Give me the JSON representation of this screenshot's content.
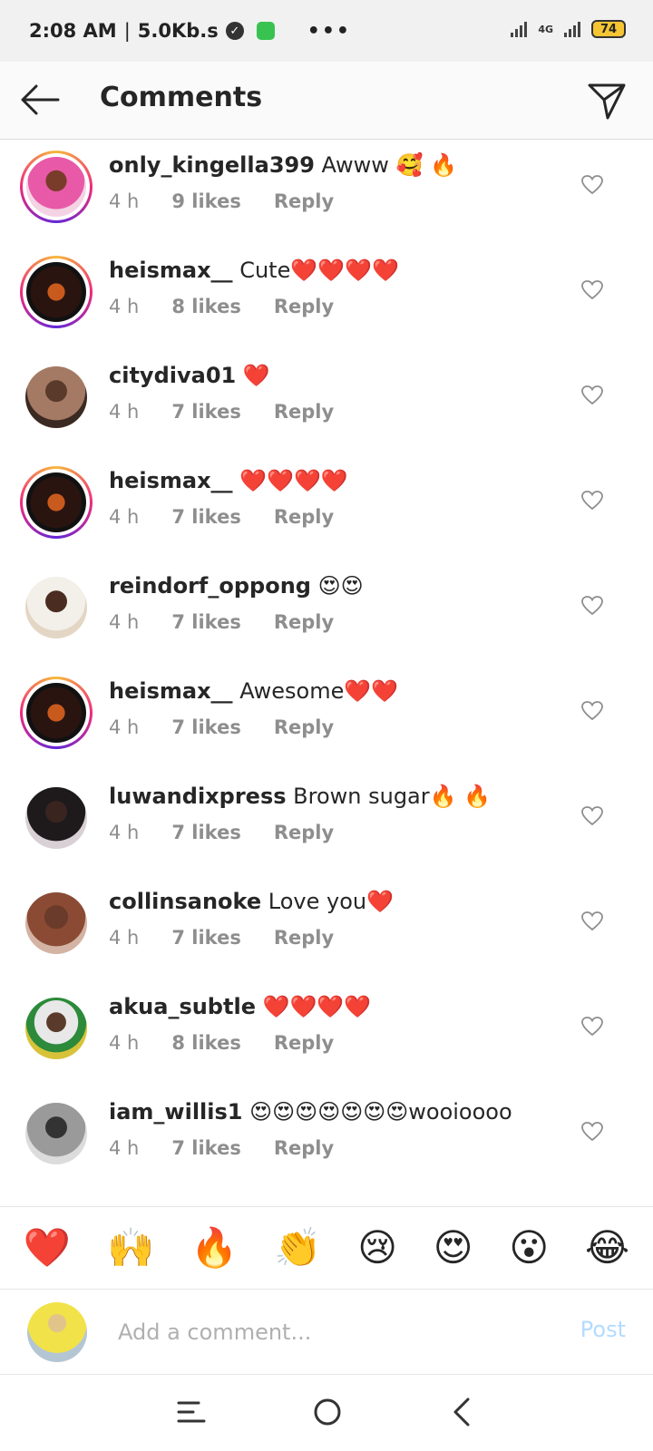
{
  "status_bar": {
    "time": "2:08 AM",
    "speed": "5.0Kb.s",
    "more": "•••",
    "network": "4G",
    "battery": "74"
  },
  "header": {
    "title": "Comments"
  },
  "comments": [
    {
      "user": "only_kingella399",
      "text": "Awww 🥰 🔥",
      "time": "4 h",
      "likes": "9 likes",
      "reply": "Reply",
      "story_ring": true
    },
    {
      "user": "heismax__",
      "text": "Cute❤️❤️❤️❤️",
      "time": "4 h",
      "likes": "8 likes",
      "reply": "Reply",
      "story_ring": true
    },
    {
      "user": "citydiva01",
      "text": "❤️",
      "time": "4 h",
      "likes": "7 likes",
      "reply": "Reply",
      "story_ring": false
    },
    {
      "user": "heismax__",
      "text": "❤️❤️❤️❤️",
      "time": "4 h",
      "likes": "7 likes",
      "reply": "Reply",
      "story_ring": true
    },
    {
      "user": "reindorf_oppong",
      "text": "😍😍",
      "time": "4 h",
      "likes": "7 likes",
      "reply": "Reply",
      "story_ring": false
    },
    {
      "user": "heismax__",
      "text": "Awesome❤️❤️",
      "time": "4 h",
      "likes": "7 likes",
      "reply": "Reply",
      "story_ring": true
    },
    {
      "user": "luwandixpress",
      "text": "Brown sugar🔥 🔥",
      "time": "4 h",
      "likes": "7 likes",
      "reply": "Reply",
      "story_ring": false
    },
    {
      "user": "collinsanoke",
      "text": "Love you❤️",
      "time": "4 h",
      "likes": "7 likes",
      "reply": "Reply",
      "story_ring": false
    },
    {
      "user": "akua_subtle",
      "text": "❤️❤️❤️❤️",
      "time": "4 h",
      "likes": "8 likes",
      "reply": "Reply",
      "story_ring": false
    },
    {
      "user": "iam_willis1",
      "text": "😍😍😍😍😍😍😍wooioooo",
      "time": "4 h",
      "likes": "7 likes",
      "reply": "Reply",
      "story_ring": false
    }
  ],
  "emoji_bar": [
    "❤️",
    "🙌",
    "🔥",
    "👏",
    "😢",
    "😍",
    "😮",
    "😂"
  ],
  "composer": {
    "placeholder": "Add a comment...",
    "post_label": "Post"
  },
  "colors": {
    "accent": "#b3dbff",
    "muted": "#8e8e8e",
    "text": "#262626"
  }
}
